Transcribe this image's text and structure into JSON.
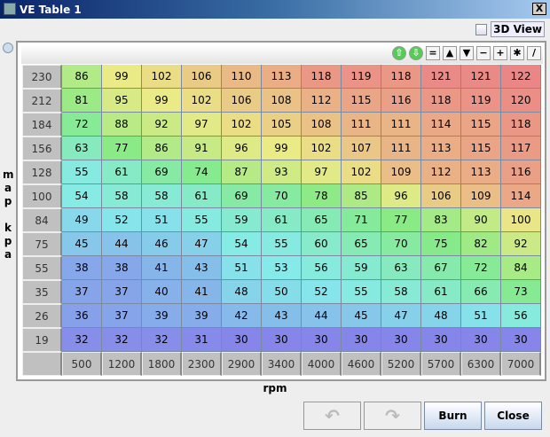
{
  "window": {
    "title": "VE Table 1",
    "close": "X"
  },
  "view3d": {
    "label": "3D View",
    "checked": false
  },
  "toolbar": [
    {
      "name": "increment-up-icon",
      "glyph": "⇧"
    },
    {
      "name": "decrement-down-icon",
      "glyph": "⇩"
    },
    {
      "name": "set-equal-button",
      "glyph": "="
    },
    {
      "name": "increase-button",
      "glyph": "▲"
    },
    {
      "name": "decrease-button",
      "glyph": "▼"
    },
    {
      "name": "subtract-button",
      "glyph": "−"
    },
    {
      "name": "add-button",
      "glyph": "+"
    },
    {
      "name": "multiply-button",
      "glyph": "✱"
    },
    {
      "name": "interpolate-button",
      "glyph": "/"
    }
  ],
  "y_axis": {
    "label": "map kpa",
    "values": [
      "230",
      "212",
      "184",
      "156",
      "128",
      "100",
      "84",
      "75",
      "55",
      "35",
      "26",
      "19"
    ]
  },
  "x_axis": {
    "label": "rpm",
    "values": [
      "500",
      "1200",
      "1800",
      "2300",
      "2900",
      "3400",
      "4000",
      "4600",
      "5200",
      "5700",
      "6300",
      "7000"
    ]
  },
  "table": [
    [
      86,
      99,
      102,
      106,
      110,
      113,
      118,
      119,
      118,
      121,
      121,
      122
    ],
    [
      81,
      95,
      99,
      102,
      106,
      108,
      112,
      115,
      116,
      118,
      119,
      120
    ],
    [
      72,
      88,
      92,
      97,
      102,
      105,
      108,
      111,
      111,
      114,
      115,
      118
    ],
    [
      63,
      77,
      86,
      91,
      96,
      99,
      102,
      107,
      111,
      113,
      115,
      117
    ],
    [
      55,
      61,
      69,
      74,
      87,
      93,
      97,
      102,
      109,
      112,
      113,
      116
    ],
    [
      54,
      58,
      58,
      61,
      69,
      70,
      78,
      85,
      96,
      106,
      109,
      114
    ],
    [
      49,
      52,
      51,
      55,
      59,
      61,
      65,
      71,
      77,
      83,
      90,
      100
    ],
    [
      45,
      44,
      46,
      47,
      54,
      55,
      60,
      65,
      70,
      75,
      82,
      92
    ],
    [
      38,
      38,
      41,
      43,
      51,
      53,
      56,
      59,
      63,
      67,
      72,
      84
    ],
    [
      37,
      37,
      40,
      41,
      48,
      50,
      52,
      55,
      58,
      61,
      66,
      73
    ],
    [
      36,
      37,
      39,
      39,
      42,
      43,
      44,
      45,
      47,
      48,
      51,
      56
    ],
    [
      32,
      32,
      32,
      31,
      30,
      30,
      30,
      30,
      30,
      30,
      30,
      30
    ]
  ],
  "buttons": {
    "undo": "↶",
    "redo": "↷",
    "burn": "Burn",
    "close": "Close"
  }
}
